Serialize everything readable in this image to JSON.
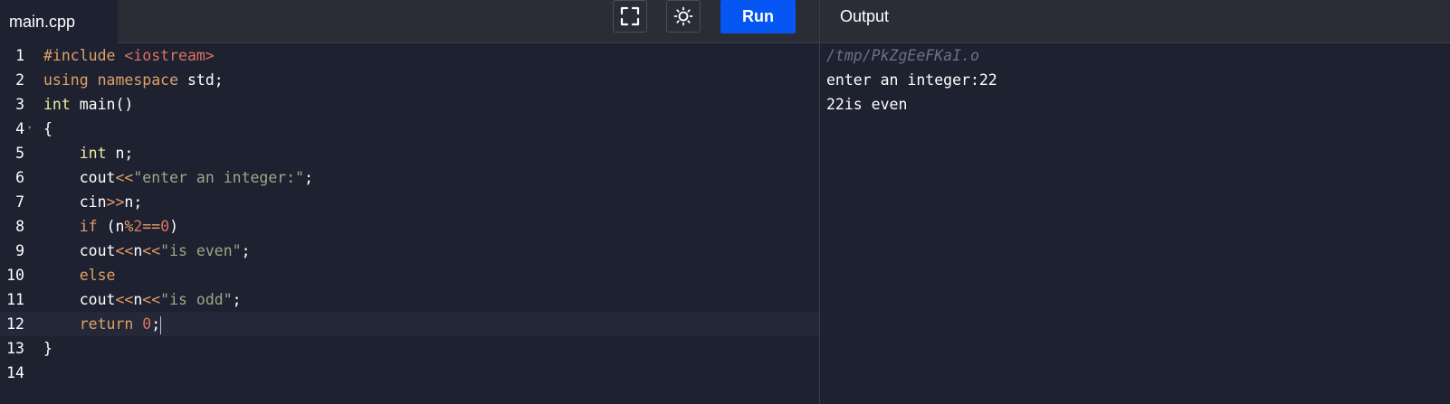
{
  "editor": {
    "filename": "main.cpp",
    "run_label": "Run",
    "icons": {
      "fullscreen": "fullscreen-icon",
      "theme": "sun-icon"
    },
    "line_numbers": [
      "1",
      "2",
      "3",
      "4",
      "5",
      "6",
      "7",
      "8",
      "9",
      "10",
      "11",
      "12",
      "13",
      "14"
    ],
    "lines": [
      [
        {
          "t": "#include ",
          "c": "kw"
        },
        {
          "t": "<iostream>",
          "c": "hdr"
        }
      ],
      [
        {
          "t": "using ",
          "c": "kw"
        },
        {
          "t": "namespace ",
          "c": "kw"
        },
        {
          "t": "std;",
          "c": "plain"
        }
      ],
      [
        {
          "t": "int ",
          "c": "type"
        },
        {
          "t": "main()",
          "c": "plain"
        }
      ],
      [
        {
          "t": "{",
          "c": "plain"
        }
      ],
      [
        {
          "t": "    ",
          "c": "plain"
        },
        {
          "t": "int ",
          "c": "type"
        },
        {
          "t": "n;",
          "c": "plain"
        }
      ],
      [
        {
          "t": "    cout",
          "c": "plain"
        },
        {
          "t": "<<",
          "c": "op"
        },
        {
          "t": "\"enter an integer:\"",
          "c": "str"
        },
        {
          "t": ";",
          "c": "plain"
        }
      ],
      [
        {
          "t": "    cin",
          "c": "plain"
        },
        {
          "t": ">>",
          "c": "op"
        },
        {
          "t": "n;",
          "c": "plain"
        }
      ],
      [
        {
          "t": "    ",
          "c": "plain"
        },
        {
          "t": "if ",
          "c": "kw"
        },
        {
          "t": "(n",
          "c": "plain"
        },
        {
          "t": "%",
          "c": "op"
        },
        {
          "t": "2",
          "c": "num"
        },
        {
          "t": "==",
          "c": "op"
        },
        {
          "t": "0",
          "c": "num"
        },
        {
          "t": ")",
          "c": "plain"
        }
      ],
      [
        {
          "t": "    cout",
          "c": "plain"
        },
        {
          "t": "<<",
          "c": "op"
        },
        {
          "t": "n",
          "c": "plain"
        },
        {
          "t": "<<",
          "c": "op"
        },
        {
          "t": "\"is even\"",
          "c": "str"
        },
        {
          "t": ";",
          "c": "plain"
        }
      ],
      [
        {
          "t": "    ",
          "c": "plain"
        },
        {
          "t": "else",
          "c": "kw"
        }
      ],
      [
        {
          "t": "    cout",
          "c": "plain"
        },
        {
          "t": "<<",
          "c": "op"
        },
        {
          "t": "n",
          "c": "plain"
        },
        {
          "t": "<<",
          "c": "op"
        },
        {
          "t": "\"is odd\"",
          "c": "str"
        },
        {
          "t": ";",
          "c": "plain"
        }
      ],
      [
        {
          "t": "    ",
          "c": "plain"
        },
        {
          "t": "return ",
          "c": "kw"
        },
        {
          "t": "0",
          "c": "num"
        },
        {
          "t": ";",
          "c": "plain"
        }
      ],
      [
        {
          "t": "}",
          "c": "plain"
        }
      ],
      []
    ],
    "active_line": 12,
    "fold_marker_line": 4
  },
  "output": {
    "title": "Output",
    "path": "/tmp/PkZgEeFKaI.o",
    "lines": [
      "enter an integer:22",
      "22is even"
    ]
  }
}
